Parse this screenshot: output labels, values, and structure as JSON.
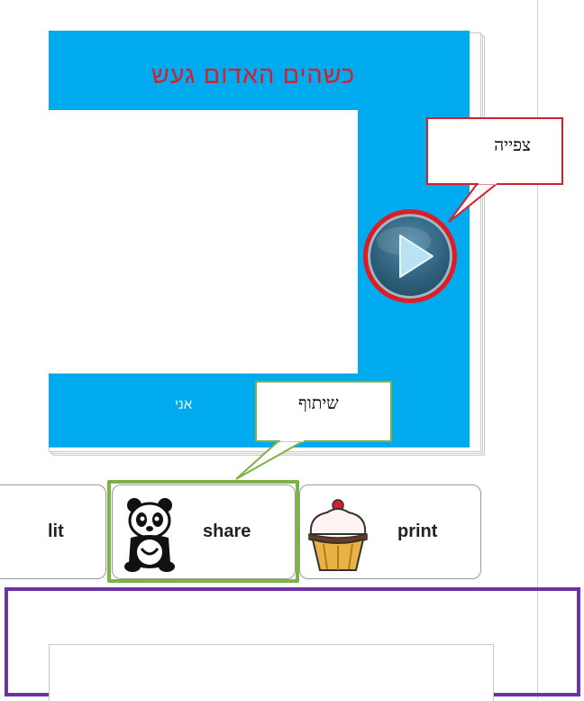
{
  "book": {
    "title": "כשהים האדום געש",
    "author": "אני",
    "cover_color": "#00aaee",
    "title_color": "#d4202a"
  },
  "callouts": {
    "view": "צפייה",
    "share": "שיתוף"
  },
  "actions": {
    "edit_label": "lit",
    "share_label": "share",
    "print_label": "print"
  },
  "colors": {
    "highlight_red": "#e01b22",
    "highlight_green": "#7db343",
    "panel_purple": "#6a35a3"
  }
}
